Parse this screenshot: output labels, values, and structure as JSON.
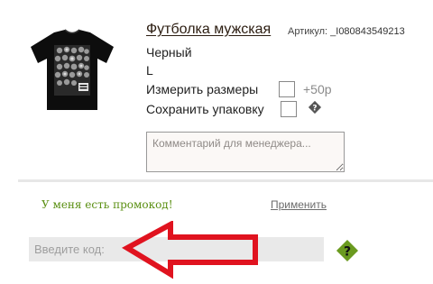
{
  "product": {
    "title": "Футболка мужская",
    "sku_label": "Артикул:",
    "sku_value": "_I080843549213",
    "color": "Черный",
    "size": "L"
  },
  "options": {
    "measure_label": "Измерить размеры",
    "measure_price": "+50р",
    "pack_label": "Сохранить упаковку"
  },
  "comment": {
    "placeholder": "Комментарий для менеджера..."
  },
  "promo": {
    "prompt": "У меня есть промокод!",
    "apply_label": "Применить",
    "input_placeholder": "Введите код:"
  },
  "colors": {
    "promo_green": "#5a8f12",
    "help_green": "#6a9a1f",
    "annotation_red": "#e0131f"
  },
  "icons": {
    "help_small": "question-diamond-icon",
    "help_large": "question-diamond-icon",
    "annotation": "arrow-left-icon"
  }
}
